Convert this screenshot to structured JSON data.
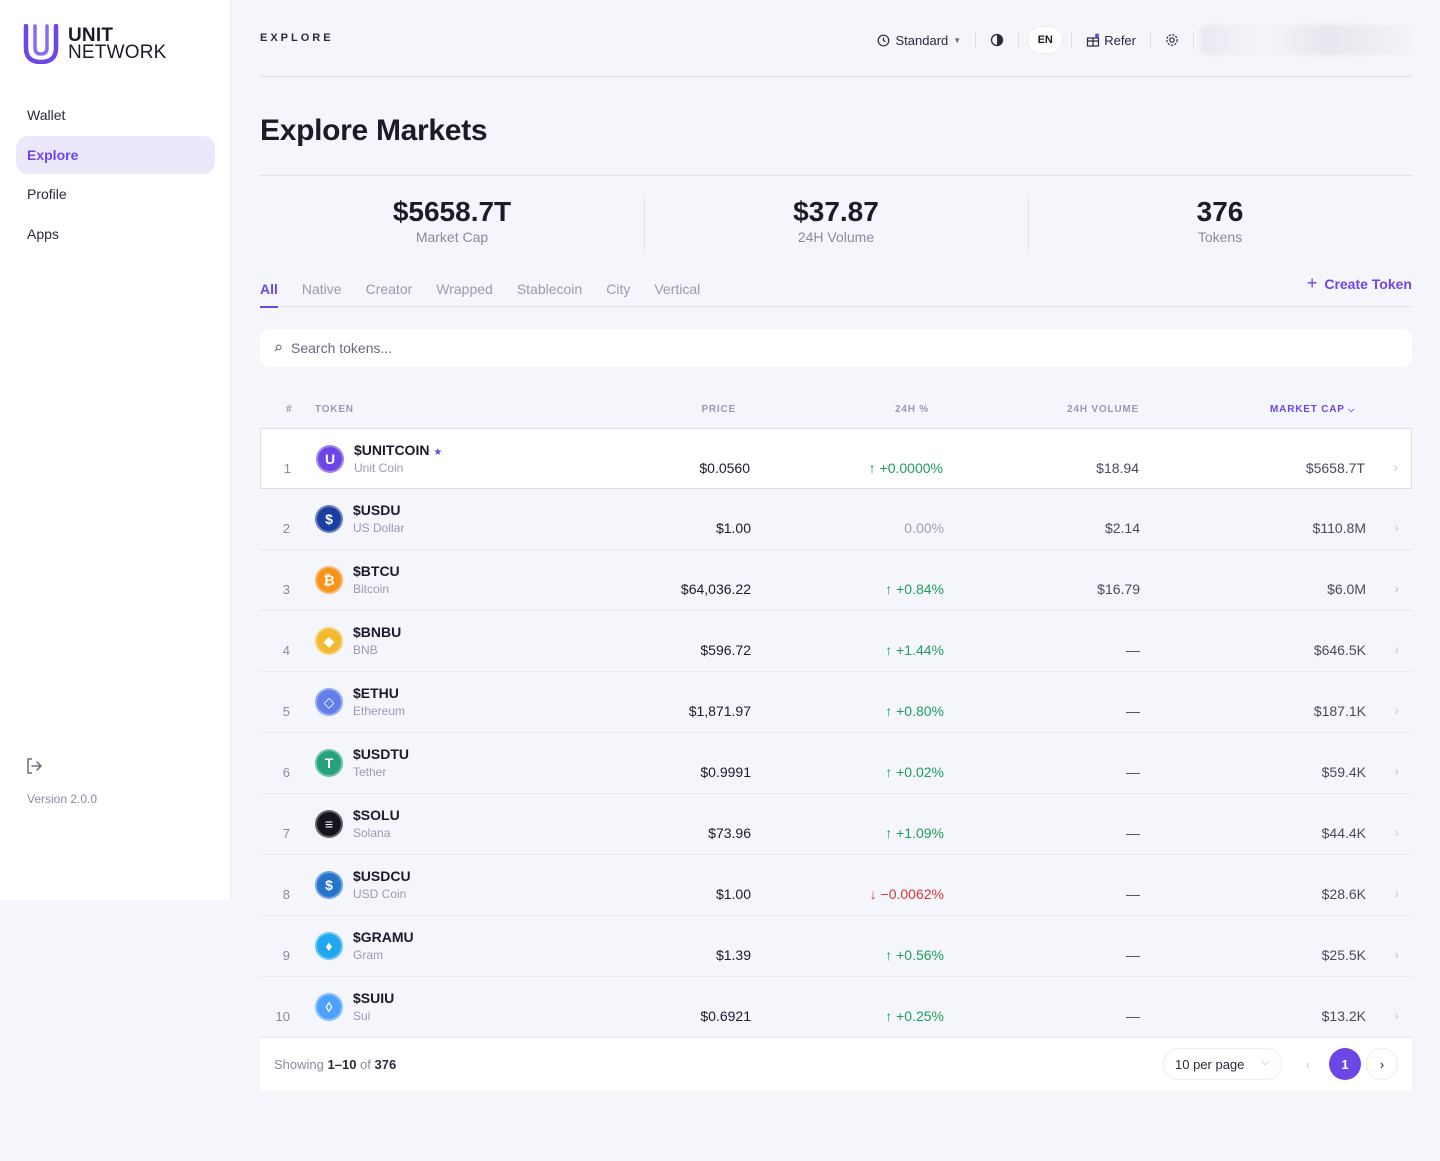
{
  "brand": {
    "line1": "UNIT",
    "line2": "NETWORK"
  },
  "sidebar": {
    "items": [
      {
        "label": "Wallet",
        "active": false
      },
      {
        "label": "Explore",
        "active": true
      },
      {
        "label": "Profile",
        "active": false
      },
      {
        "label": "Apps",
        "active": false
      }
    ],
    "version": "Version 2.0.0"
  },
  "topbar": {
    "title": "EXPLORE",
    "mode": "Standard",
    "lang": "EN",
    "refer": "Refer"
  },
  "page": {
    "title": "Explore Markets"
  },
  "stats": [
    {
      "value": "$5658.7T",
      "label": "Market Cap"
    },
    {
      "value": "$37.87",
      "label": "24H Volume"
    },
    {
      "value": "376",
      "label": "Tokens"
    }
  ],
  "tabs": [
    "All",
    "Native",
    "Creator",
    "Wrapped",
    "Stablecoin",
    "City",
    "Vertical"
  ],
  "active_tab": "All",
  "create_token": "Create Token",
  "search": {
    "placeholder": "Search tokens..."
  },
  "table": {
    "headers": {
      "num": "#",
      "token": "TOKEN",
      "price": "PRICE",
      "pct": "24H %",
      "volume": "24H VOLUME",
      "cap": "MARKET CAP"
    },
    "rows": [
      {
        "num": "1",
        "symbol": "$UNITCOIN",
        "name": "Unit Coin",
        "price": "$0.0560",
        "pct": "↑ +0.0000%",
        "dir": "pos",
        "volume": "$18.94",
        "cap": "$5658.7T",
        "icon": "unit-icon",
        "color": "#6d47e6"
      },
      {
        "num": "2",
        "symbol": "$USDU",
        "name": "US Dollar",
        "price": "$1.00",
        "pct": "0.00%",
        "dir": "neu",
        "volume": "$2.14",
        "cap": "$110.8M",
        "icon": "usd-icon",
        "color": "#1b3f9e"
      },
      {
        "num": "3",
        "symbol": "$BTCU",
        "name": "Bitcoin",
        "price": "$64,036.22",
        "pct": "↑ +0.84%",
        "dir": "pos",
        "volume": "$16.79",
        "cap": "$6.0M",
        "icon": "bitcoin-icon",
        "color": "#f7931a"
      },
      {
        "num": "4",
        "symbol": "$BNBU",
        "name": "BNB",
        "price": "$596.72",
        "pct": "↑ +1.44%",
        "dir": "pos",
        "volume": "—",
        "cap": "$646.5K",
        "icon": "bnb-icon",
        "color": "#f3ba2f"
      },
      {
        "num": "5",
        "symbol": "$ETHU",
        "name": "Ethereum",
        "price": "$1,871.97",
        "pct": "↑ +0.80%",
        "dir": "pos",
        "volume": "—",
        "cap": "$187.1K",
        "icon": "ethereum-icon",
        "color": "#627eea"
      },
      {
        "num": "6",
        "symbol": "$USDTU",
        "name": "Tether",
        "price": "$0.9991",
        "pct": "↑ +0.02%",
        "dir": "pos",
        "volume": "—",
        "cap": "$59.4K",
        "icon": "tether-icon",
        "color": "#26a17b"
      },
      {
        "num": "7",
        "symbol": "$SOLU",
        "name": "Solana",
        "price": "$73.96",
        "pct": "↑ +1.09%",
        "dir": "pos",
        "volume": "—",
        "cap": "$44.4K",
        "icon": "solana-icon",
        "color": "#14151f"
      },
      {
        "num": "8",
        "symbol": "$USDCU",
        "name": "USD Coin",
        "price": "$1.00",
        "pct": "↓ −0.0062%",
        "dir": "neg",
        "volume": "—",
        "cap": "$28.6K",
        "icon": "usdc-icon",
        "color": "#2775ca"
      },
      {
        "num": "9",
        "symbol": "$GRAMU",
        "name": "Gram",
        "price": "$1.39",
        "pct": "↑ +0.56%",
        "dir": "pos",
        "volume": "—",
        "cap": "$25.5K",
        "icon": "gram-icon",
        "color": "#1fa8f0"
      },
      {
        "num": "10",
        "symbol": "$SUIU",
        "name": "Sui",
        "price": "$0.6921",
        "pct": "↑ +0.25%",
        "dir": "pos",
        "volume": "—",
        "cap": "$13.2K",
        "icon": "sui-icon",
        "color": "#4da2ff"
      }
    ]
  },
  "footer": {
    "showing_prefix": "Showing",
    "range": "1–10",
    "of": "of",
    "total": "376",
    "per_page": "10 per page",
    "current_page": "1"
  },
  "colors": {
    "accent": "#6d47e6",
    "positive": "#1e9e5a",
    "negative": "#d23a3a"
  }
}
